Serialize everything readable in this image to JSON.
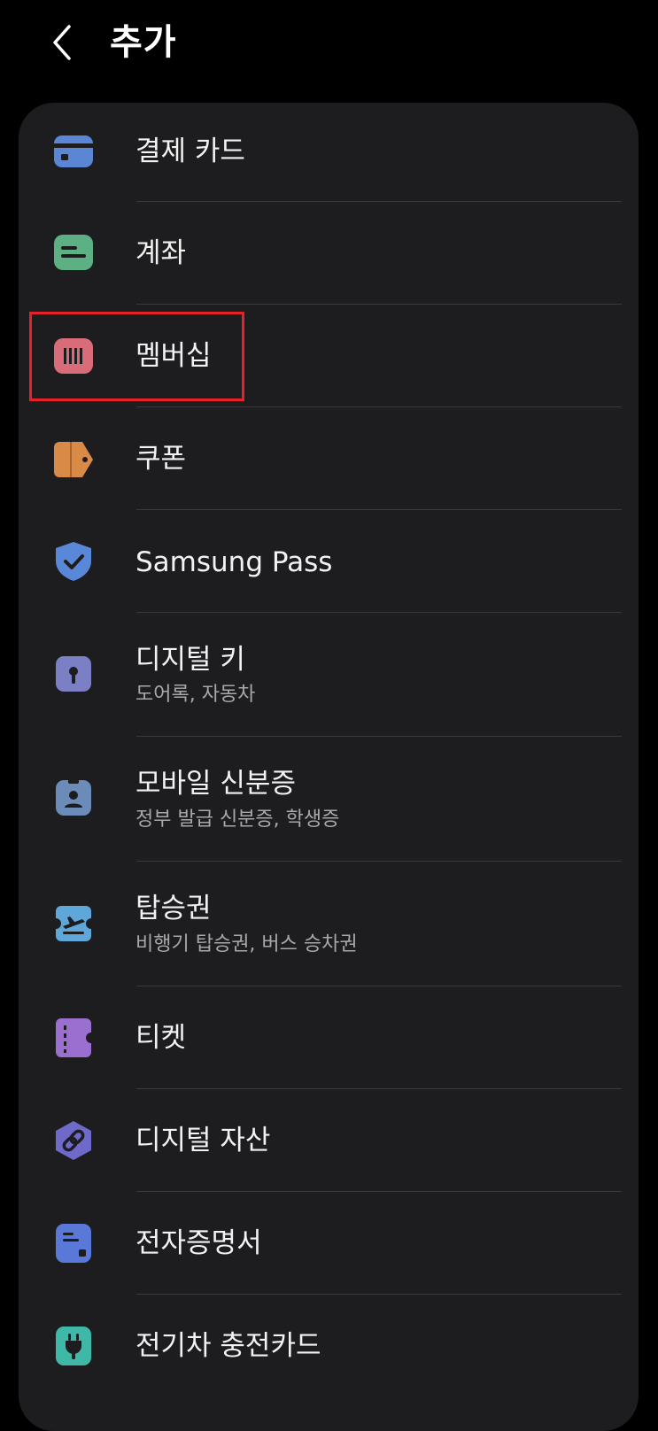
{
  "header": {
    "back_icon": "chevron-left-icon",
    "title": "추가"
  },
  "menu": {
    "items": [
      {
        "label": "결제 카드",
        "icon": "payment-card-icon",
        "icon_color": "#5b86d6"
      },
      {
        "label": "계좌",
        "icon": "bank-account-icon",
        "icon_color": "#5cb083"
      },
      {
        "label": "멤버십",
        "icon": "membership-barcode-icon",
        "icon_color": "#d86c78"
      },
      {
        "label": "쿠폰",
        "icon": "coupon-tag-icon",
        "icon_color": "#d98a46"
      },
      {
        "label": "Samsung Pass",
        "icon": "shield-check-icon",
        "icon_color": "#5a88d8"
      },
      {
        "label": "디지털 키",
        "sub": "도어록, 자동차",
        "icon": "keyhole-icon",
        "icon_color": "#7b7fc4"
      },
      {
        "label": "모바일 신분증",
        "sub": "정부 발급 신분증, 학생증",
        "icon": "id-card-icon",
        "icon_color": "#6b8cb8"
      },
      {
        "label": "탑승권",
        "sub": "비행기 탑승권, 버스 승차권",
        "icon": "boarding-pass-icon",
        "icon_color": "#5fa7d9"
      },
      {
        "label": "티켓",
        "icon": "ticket-icon",
        "icon_color": "#9b6fd0"
      },
      {
        "label": "디지털 자산",
        "icon": "digital-asset-link-icon",
        "icon_color": "#6f69c9"
      },
      {
        "label": "전자증명서",
        "icon": "certificate-doc-icon",
        "icon_color": "#5a78d8"
      },
      {
        "label": "전기차 충전카드",
        "icon": "ev-plug-icon",
        "icon_color": "#3fb8a8"
      }
    ]
  },
  "highlight": {
    "target": "멤버십",
    "color": "#e8202a"
  }
}
